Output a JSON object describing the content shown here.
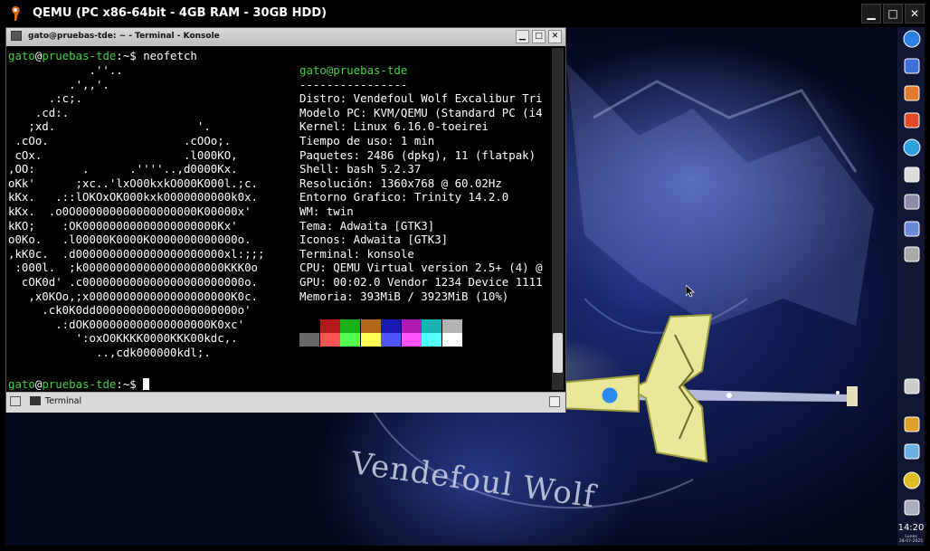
{
  "qemu": {
    "title": "QEMU (PC x86-64bit - 4GB RAM - 30GB HDD)",
    "minimize_glyph": "▁",
    "maximize_glyph": "□",
    "close_glyph": "✕"
  },
  "konsole": {
    "title": "gato@pruebas-tde: ~ - Terminal - Konsole",
    "tab_label": "Terminal",
    "minimize_glyph": "▁",
    "maximize_glyph": "□",
    "close_glyph": "✕"
  },
  "prompt": {
    "user": "gato",
    "at": "@",
    "host": "pruebas-tde",
    "path_sep": ":~$ ",
    "command": "neofetch"
  },
  "ascii_logo": [
    "            .''..",
    "         .',,'.",
    "      .:c;.",
    "    .cd:.",
    "   ;xd.                     '.",
    " .cOo.                    .cOOo;.",
    " cOx.                     .l000KO,",
    ",OO:       .      .''''..,d0000Kx.",
    "oKk'      ;xc..'lxO00kxkO000K000l.;c.",
    "kKx.   .::lOKOxOK000kxk0000000000k0x.",
    "kKx.  .o0O000000000000000000K00000x'",
    "kKO;    :OK00000000000000000000Kx'",
    "o0Ko.   .l00000K0000K0000000000000o.",
    ",kK0c.  .d0000000000000000000000xl:;;;",
    " :000l.  ;k000000000000000000000KKK0o",
    "  cOK0d' .c000000000000000000000000o.",
    "   ,x0KOo,;x000000000000000000000K0c.",
    "     .ck0K0dd000000000000000000000o'",
    "       .:dOK000000000000000000K0xc'",
    "          ':oxO0KKKK0000KKK00kdc,.",
    "             ..,cdk000000kdl;."
  ],
  "system_info": {
    "header": "gato@pruebas-tde",
    "separator": "----------------",
    "lines": [
      "Distro: Vendefoul Wolf Excalibur Tri",
      "Modelo PC: KVM/QEMU (Standard PC (i4",
      "Kernel: Linux 6.16.0-toeirei",
      "Tiempo de uso: 1 min",
      "Paquetes: 2486 (dpkg), 11 (flatpak)",
      "Shell: bash 5.2.37",
      "Resolución: 1360x768 @ 60.02Hz",
      "Entorno Grafico: Trinity 14.2.0",
      "WM: twin",
      "Tema: Adwaita [GTK3]",
      "Iconos: Adwaita [GTK3]",
      "Terminal: konsole",
      "CPU: QEMU Virtual version 2.5+ (4) @",
      "GPU: 00:02.0 Vendor 1234 Device 1111",
      "Memoria: 393MiB / 3923MiB (10%)"
    ]
  },
  "color_palette": {
    "top": [
      "#000000",
      "#b21818",
      "#18b218",
      "#b26818",
      "#1818b2",
      "#b218b2",
      "#18b2b2",
      "#b2b2b2"
    ],
    "bottom": [
      "#686868",
      "#ff5454",
      "#54ff54",
      "#ffff54",
      "#5454ff",
      "#ff54ff",
      "#54ffff",
      "#ffffff"
    ]
  },
  "wallpaper": {
    "text": "Vendefoul Wolf"
  },
  "panel": {
    "icons": [
      "globe-icon",
      "paint-icon",
      "wrench-icon",
      "home-icon",
      "safari-icon",
      "monitor-icon",
      "calculator-icon",
      "display-settings-icon",
      "small-display-icon",
      "network-icon",
      "weather-icon",
      "trash-icon",
      "chat-icon",
      "volume-icon"
    ],
    "clock": "14:20",
    "day": "Lunes",
    "date": "28-07-2025"
  },
  "colors": {
    "prompt_green": "#3fd23f",
    "terminal_bg": "#000000",
    "terminal_fg": "#ffffff"
  }
}
